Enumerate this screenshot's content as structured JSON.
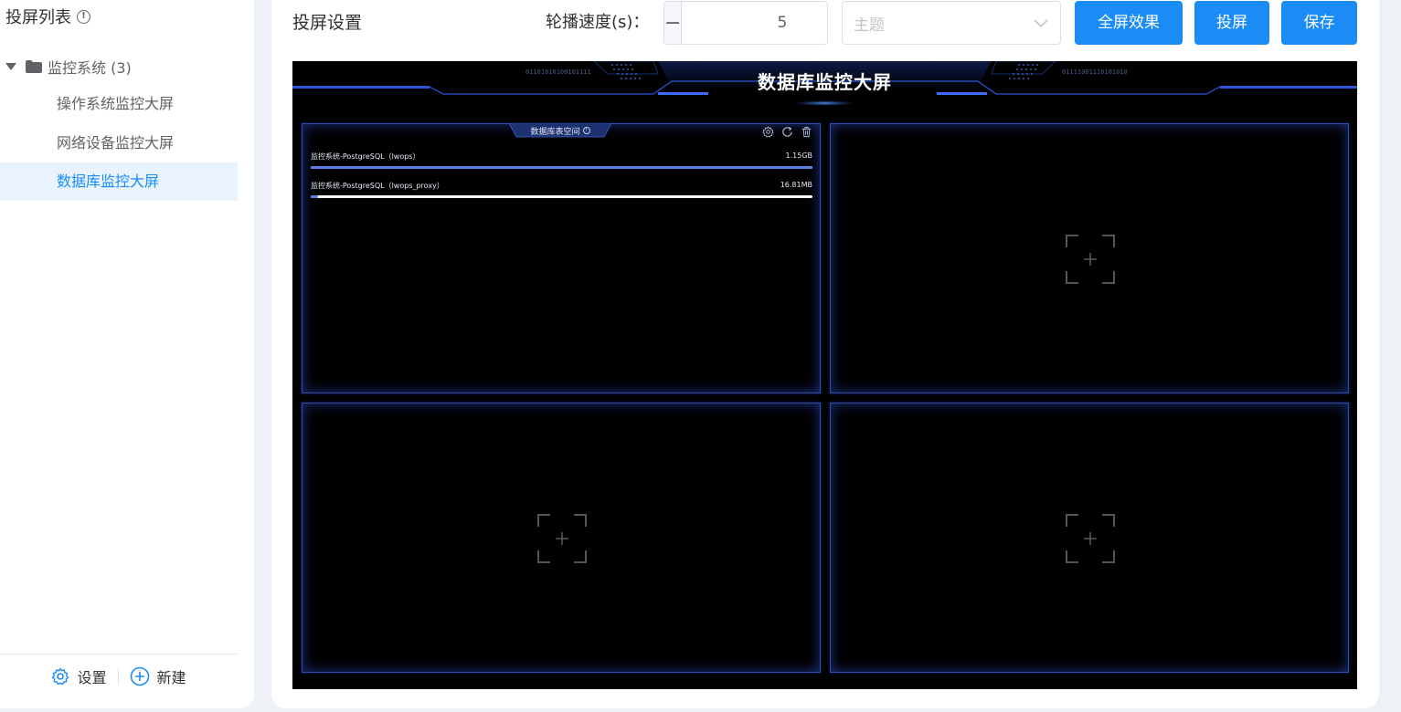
{
  "sidebar": {
    "title": "投屏列表",
    "group": {
      "label": "监控系统 (3)"
    },
    "items": [
      {
        "label": "操作系统监控大屏",
        "active": false
      },
      {
        "label": "网络设备监控大屏",
        "active": false
      },
      {
        "label": "数据库监控大屏",
        "active": true
      }
    ],
    "footer": {
      "settings_label": "设置",
      "new_label": "新建"
    }
  },
  "main": {
    "title": "投屏设置",
    "speed_label": "轮播速度(s)：",
    "speed_value": "5",
    "theme_placeholder": "主题",
    "buttons": {
      "fullscreen": "全屏效果",
      "cast": "投屏",
      "save": "保存"
    }
  },
  "dashboard": {
    "title": "数据库监控大屏",
    "binary_left": "01101010100101111",
    "binary_right": "01111001110101010",
    "panel": {
      "title": "数据库表空间",
      "rows": [
        {
          "name": "监控系统-PostgreSQL（lwops）",
          "size": "1.15GB",
          "fill": 1.0
        },
        {
          "name": "监控系统-PostgreSQL（lwops_proxy）",
          "size": "16.81MB",
          "fill": 0.015
        }
      ]
    }
  },
  "colors": {
    "accent": "#1a8cf6",
    "active_bg": "#e8f3fe",
    "dash_bg": "#000000",
    "panel_border": "#2e4fb3",
    "bar_fill": "#5b7fe0"
  }
}
